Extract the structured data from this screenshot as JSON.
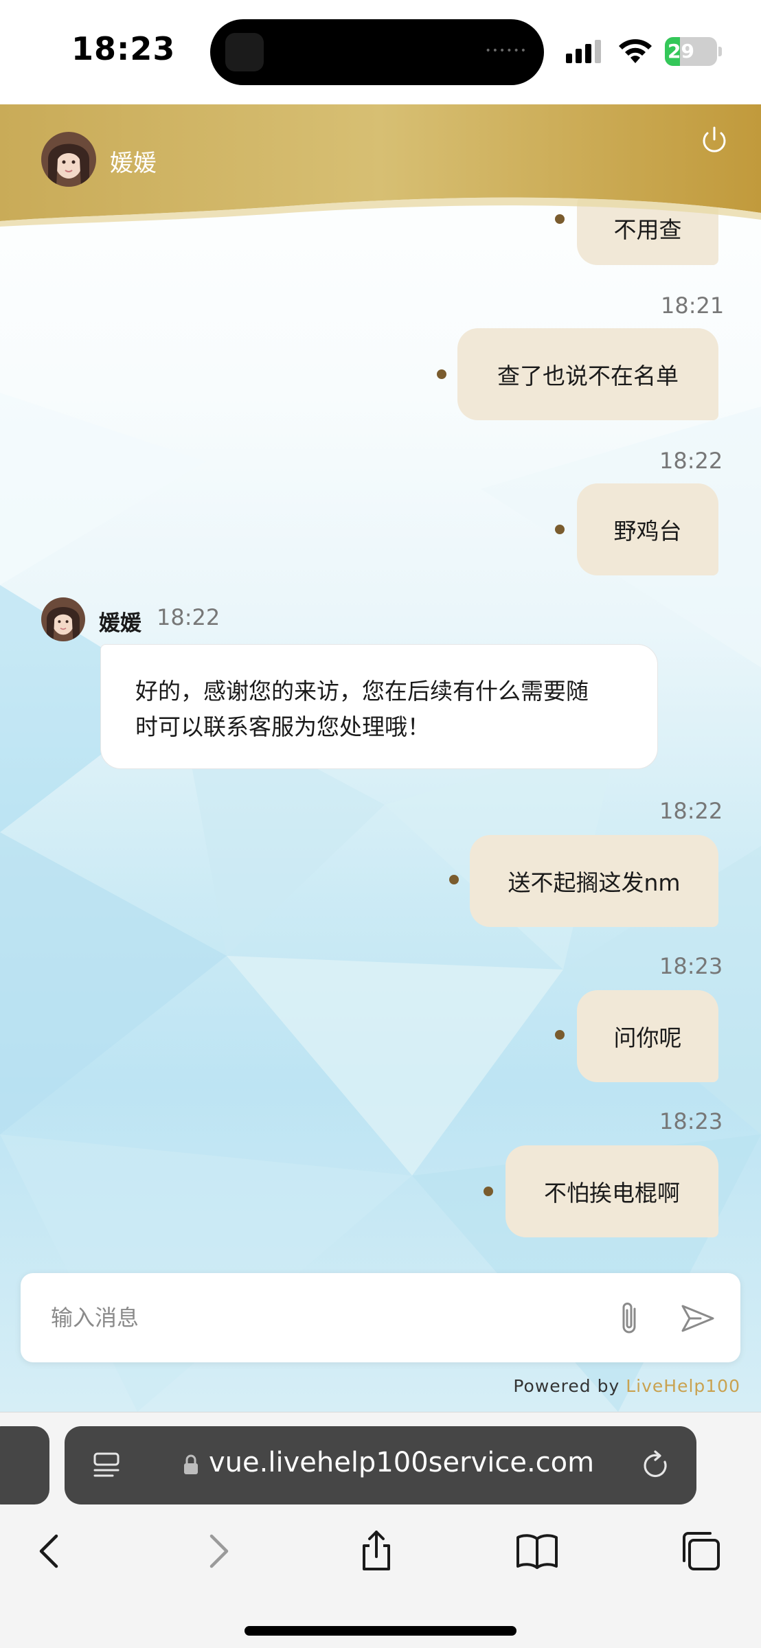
{
  "status_bar": {
    "time": "18:23",
    "battery": "29",
    "battery_level": 0.29,
    "icons": [
      "signal-icon",
      "wifi-icon",
      "battery-charging-icon"
    ]
  },
  "header": {
    "agent_name": "媛媛",
    "icons": [
      "avatar",
      "power-icon"
    ],
    "accent": "#c6a54e"
  },
  "messages": [
    {
      "direction": "out",
      "text": "不用查",
      "time": ""
    },
    {
      "direction": "out",
      "text": "查了也说不在名单",
      "time": "18:21"
    },
    {
      "direction": "out",
      "text": "野鸡台",
      "time": "18:22"
    },
    {
      "direction": "in",
      "sender": "媛媛",
      "text_line1": "好的，感谢您的来访，您在后续有什么需要随",
      "text_line2": "时可以联系客服为您处理哦！",
      "time": "18:22"
    },
    {
      "direction": "out",
      "text": "送不起搁这发nm",
      "time": "18:22"
    },
    {
      "direction": "out",
      "text": "问你呢",
      "time": "18:23"
    },
    {
      "direction": "out",
      "text": "不怕挨电棍啊",
      "time": "18:23"
    }
  ],
  "composer": {
    "placeholder": "输入消息",
    "value": "",
    "icons": [
      "paperclip-icon",
      "send-icon"
    ]
  },
  "footer": {
    "powered_prefix": "Powered by",
    "powered_brand": "LiveHelp100",
    "brand_color": "#c9a250"
  },
  "browser": {
    "url": "vue.livehelp100service.com",
    "icons": [
      "reader-icon",
      "lock-icon",
      "reload-icon",
      "back-icon",
      "forward-icon",
      "share-icon",
      "bookmarks-icon",
      "tabs-icon"
    ]
  }
}
